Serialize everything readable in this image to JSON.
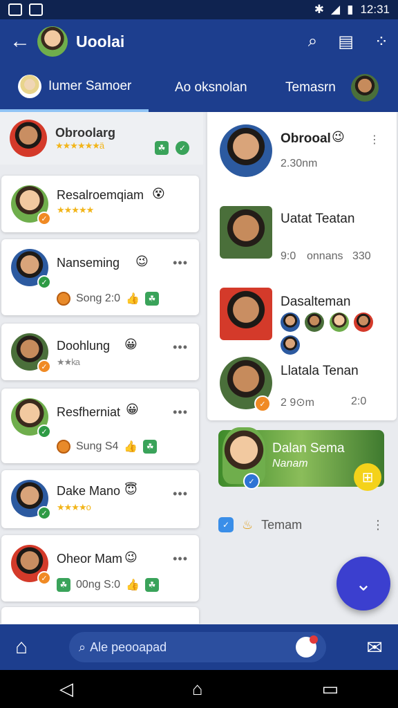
{
  "status_bar": {
    "time": "12:31"
  },
  "app_bar": {
    "title": "Uoolai"
  },
  "tabs": [
    {
      "label": "Iumer Samoer"
    },
    {
      "label": "Ao oksnolan"
    },
    {
      "label": "Temasrn"
    }
  ],
  "left_list": {
    "top": {
      "name": "Obroolarg",
      "rating_stars": "★★★★★★ä"
    },
    "items": [
      {
        "name": "Resalroemqiam",
        "stars": "★★★★★",
        "emoji": "😵",
        "meta": ""
      },
      {
        "name": "Nanseming",
        "emoji": "😉",
        "meta": "Song 2:0"
      },
      {
        "name": "Doohlung",
        "emoji": "😀",
        "stars": "★★ka",
        "meta": ""
      },
      {
        "name": "Resfherniat",
        "emoji": "😀",
        "meta": "Sung S4"
      },
      {
        "name": "Dake Mano",
        "emoji": "😇",
        "stars": "★★★★o",
        "meta": ""
      },
      {
        "name": "Oheor Mam",
        "emoji": "😉",
        "meta": "00ng S:0"
      }
    ]
  },
  "right_list": [
    {
      "name": "Obrooal",
      "emoji": "😉",
      "sub": "2.30nm"
    },
    {
      "name": "Uatat Teatan",
      "sub": "9:0",
      "sub_red": "onnans",
      "sub_extra": "330"
    },
    {
      "name": "Dasalteman",
      "sub": ""
    },
    {
      "name": "Llatala Tenan",
      "sub_red": "2 9⊙m",
      "sub_extra": "2:0"
    }
  ],
  "promo": {
    "title": "Dalan Sema",
    "subtitle": "Nanam"
  },
  "bottom_row": {
    "label": "Temam"
  },
  "search": {
    "placeholder": "Ale peooapad"
  },
  "colors": {
    "primary": "#1d3e8e",
    "fab": "#3b3fcf",
    "accent_yellow": "#f4d21a"
  }
}
